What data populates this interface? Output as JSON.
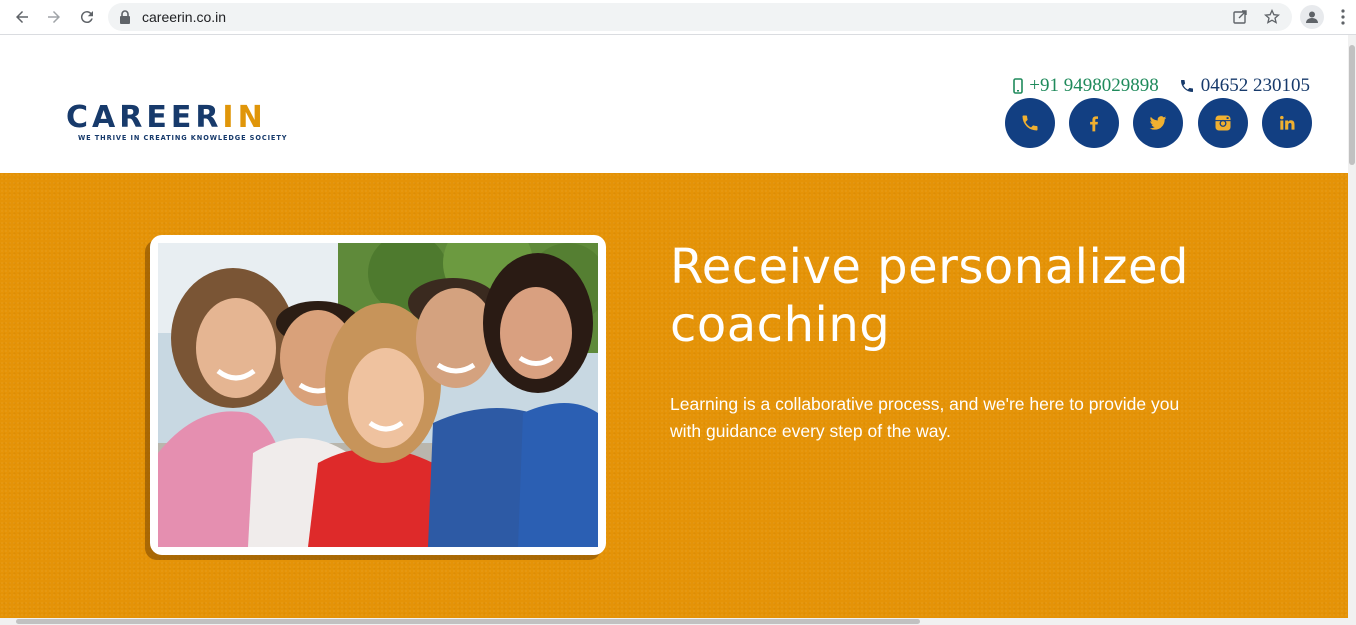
{
  "browser": {
    "url": "careerin.co.in",
    "icons": [
      "back-arrow-icon",
      "forward-arrow-icon",
      "reload-icon",
      "lock-icon",
      "share-icon",
      "star-icon",
      "profile-icon",
      "more-vert-icon"
    ]
  },
  "header": {
    "logo": {
      "part1": "CAREER",
      "part2": "IN",
      "tagline": "WE THRIVE IN CREATING KNOWLEDGE SOCIETY",
      "colors": {
        "primary": "#173a6b",
        "accent": "#e0960a"
      }
    },
    "contact": {
      "mobile": "+91 9498029898",
      "landline": "04652 230105",
      "mobile_color": "#1f8a5b",
      "landline_color": "#173a6b"
    },
    "socials": [
      {
        "name": "phone",
        "icon": "phone-icon"
      },
      {
        "name": "facebook",
        "icon": "facebook-icon"
      },
      {
        "name": "twitter",
        "icon": "twitter-icon"
      },
      {
        "name": "instagram",
        "icon": "instagram-icon"
      },
      {
        "name": "linkedin",
        "icon": "linkedin-icon"
      }
    ],
    "social_bg_color": "#123f82",
    "social_icon_color": "#f0b030"
  },
  "hero": {
    "background_color": "#e59307",
    "title": "Receive personalized coaching",
    "text": "Learning is a collaborative process, and we're here to provide you with guidance every step of the way."
  }
}
